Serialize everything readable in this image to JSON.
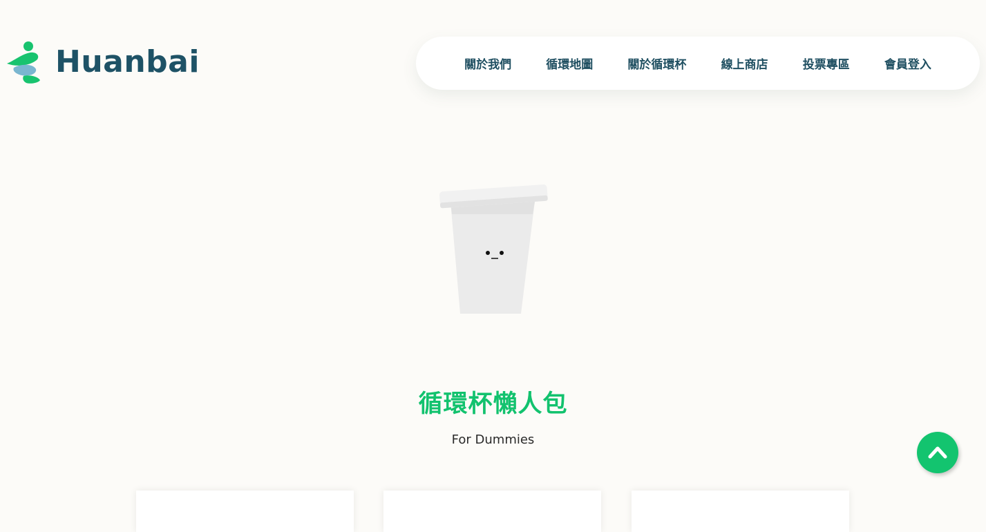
{
  "brand": {
    "name": "Huanbai",
    "colors": {
      "logo_text": "#1e5266",
      "logo_green": "#18c36f",
      "logo_blue": "#7ab6d0",
      "accent": "#12c26e"
    }
  },
  "nav": {
    "items": [
      {
        "label": "關於我們"
      },
      {
        "label": "循環地圖"
      },
      {
        "label": "關於循環杯"
      },
      {
        "label": "線上商店"
      },
      {
        "label": "投票專區"
      },
      {
        "label": "會員登入"
      }
    ]
  },
  "hero": {
    "illustration": "reusable-cup-illustration",
    "title": "循環杯懶人包",
    "subtitle": "For Dummies"
  },
  "cards_count": 3,
  "back_to_top": {
    "icon": "chevron-up-icon"
  }
}
